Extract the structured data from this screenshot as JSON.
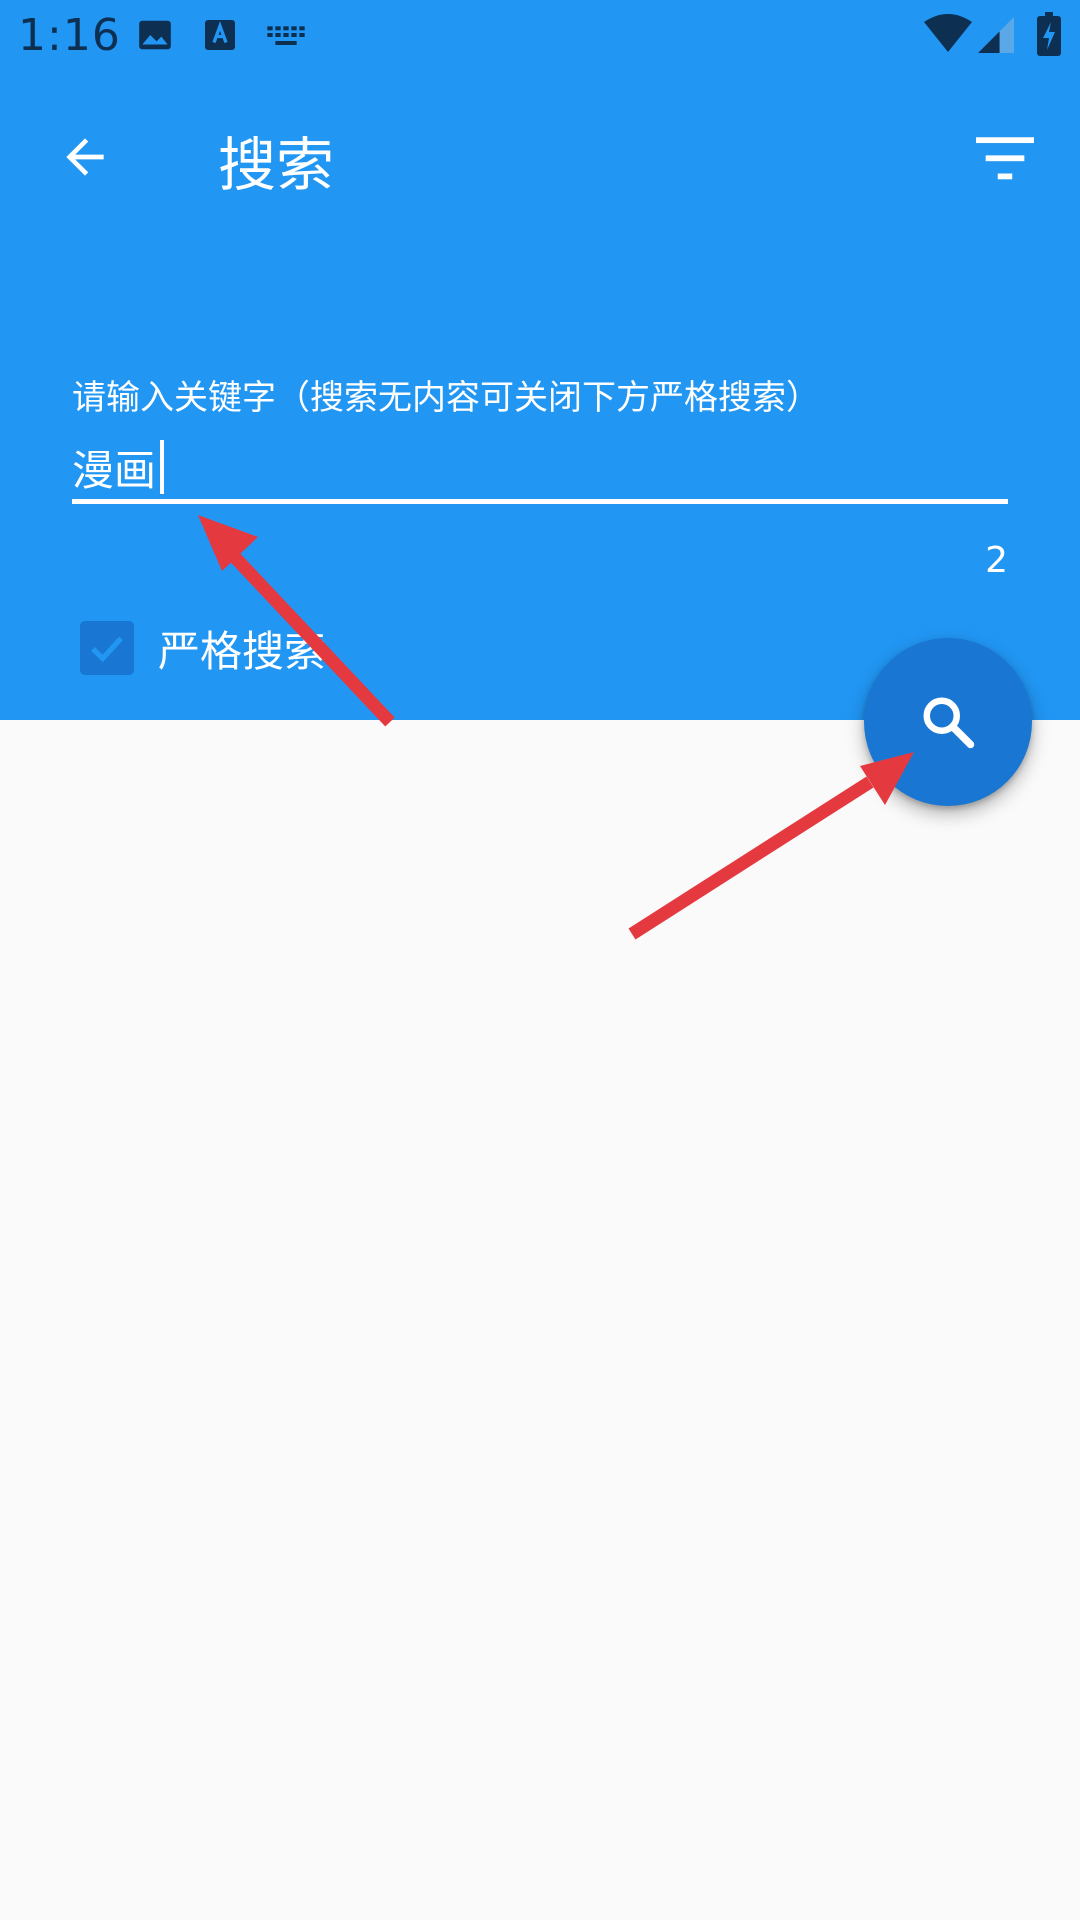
{
  "status_bar": {
    "time": "1:16",
    "icons": [
      "image-icon",
      "text-a-icon",
      "keyboard-icon",
      "wifi-icon",
      "cell-signal-icon",
      "battery-charging-icon"
    ]
  },
  "toolbar": {
    "title": "搜索",
    "back_icon": "arrow-left-icon",
    "filter_icon": "filter-icon"
  },
  "search": {
    "label": "请输入关键字（搜索无内容可关闭下方严格搜索）",
    "value": "漫画",
    "counter": "2"
  },
  "strict_search": {
    "label": "严格搜索",
    "checked": true
  },
  "fab": {
    "icon": "search-icon"
  },
  "colors": {
    "primary": "#2196f3",
    "primary_dark": "#1976d2",
    "background": "#fafafa",
    "annotation": "#e53940"
  }
}
